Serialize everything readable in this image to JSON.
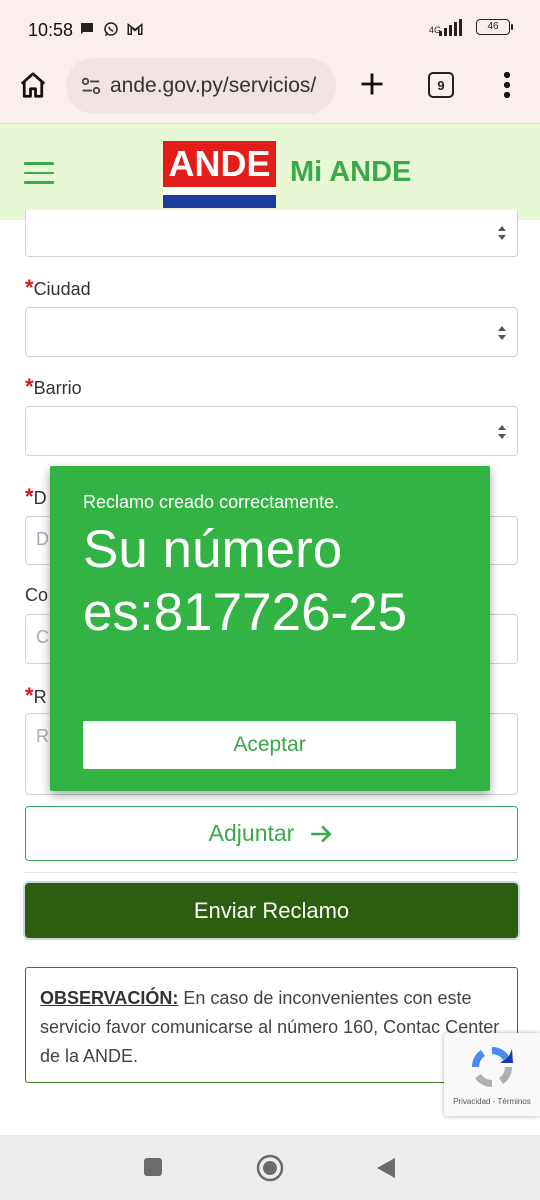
{
  "status_bar": {
    "time": "10:58",
    "network": "4G",
    "battery": "46",
    "icons": [
      "chat-bubble-icon",
      "whatsapp-icon",
      "gmail-icon",
      "signal-icon",
      "battery-icon"
    ]
  },
  "browser": {
    "url": "ande.gov.py/servicios/",
    "tab_count": "9",
    "icons": [
      "home-icon",
      "site-settings-icon",
      "plus-icon",
      "more-vert-icon"
    ]
  },
  "header": {
    "logo_text": "ANDE",
    "title": "Mi ANDE",
    "colors": {
      "header_bg": "#e8f8d4",
      "brand_green": "#3aa84b",
      "logo_red": "#e31d1a",
      "logo_blue": "#1d3b9b"
    }
  },
  "form": {
    "required_mark": "*",
    "ciudad_label": "Ciudad",
    "barrio_label": "Barrio",
    "partial_label_1": "D",
    "partial_placeholder_1": "D",
    "partial_label_2": "Co",
    "partial_placeholder_2": "C",
    "partial_label_3": "R",
    "partial_placeholder_3": "R",
    "attach_label": "Adjuntar",
    "send_label": "Enviar Reclamo"
  },
  "observation": {
    "label": "OBSERVACIÓN:",
    "text": " En caso de inconvenientes con este servicio favor comunicarse al número 160, Contac Center de la ANDE."
  },
  "recaptcha": {
    "privacy": "Privacidad",
    "separator": " - ",
    "terms": "Términos"
  },
  "modal": {
    "subtitle": "Reclamo creado correctamente.",
    "message": "Su número es:817726-25",
    "accept_label": "Aceptar",
    "bg_color": "#34b345"
  },
  "nav": {
    "icons": [
      "recents-icon",
      "home-icon",
      "back-icon"
    ]
  }
}
